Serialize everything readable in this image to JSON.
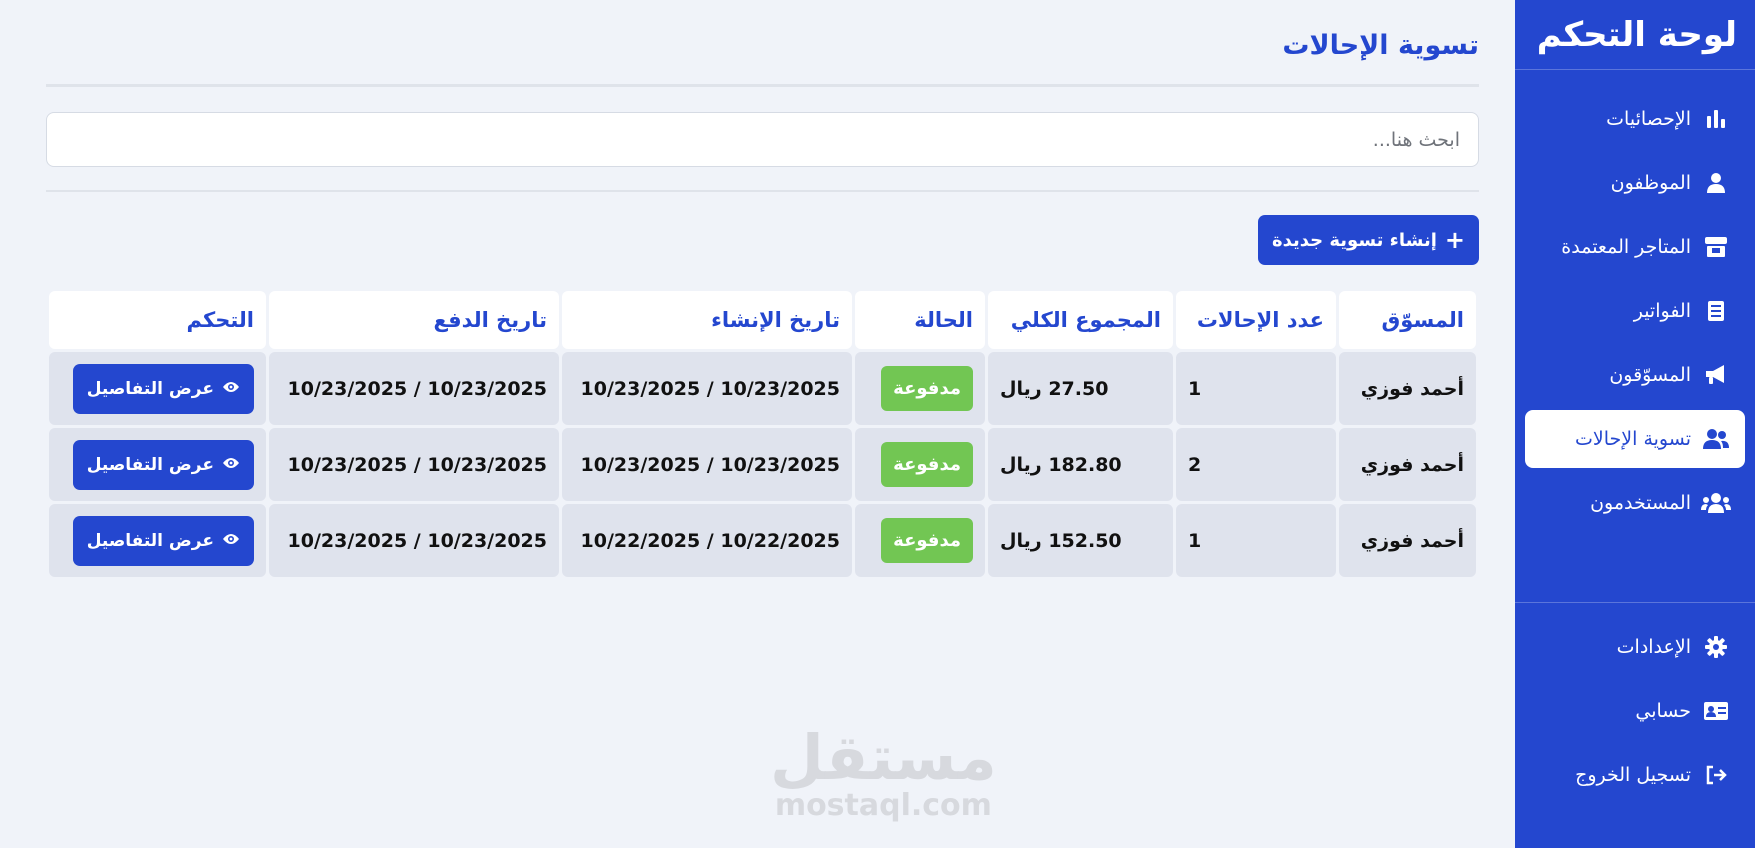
{
  "sidebar": {
    "title": "لوحة التحكم",
    "items": [
      {
        "label": "الإحصائيات",
        "icon": "chart-bar-icon"
      },
      {
        "label": "الموظفون",
        "icon": "user-tie-icon"
      },
      {
        "label": "المتاجر المعتمدة",
        "icon": "store-icon"
      },
      {
        "label": "الفواتير",
        "icon": "receipt-icon"
      },
      {
        "label": "المسوّقون",
        "icon": "megaphone-icon"
      },
      {
        "label": "تسوية الإحالات",
        "icon": "user-group-icon",
        "active": true
      },
      {
        "label": "المستخدمون",
        "icon": "users-icon"
      }
    ],
    "bottom_items": [
      {
        "label": "الإعدادات",
        "icon": "gear-icon"
      },
      {
        "label": "حسابي",
        "icon": "id-card-icon"
      },
      {
        "label": "تسجيل الخروج",
        "icon": "logout-icon"
      }
    ]
  },
  "page": {
    "title": "تسوية الإحالات",
    "search_placeholder": "ابحث هنا...",
    "create_button": "إنشاء تسوية جديدة",
    "create_button_icon": "+"
  },
  "table": {
    "headers": [
      "المسوّق",
      "عدد الإحالات",
      "المجموع الكلي",
      "الحالة",
      "تاريخ الإنشاء",
      "تاريخ الدفع",
      "التحكم"
    ],
    "rows": [
      {
        "marketer": "أحمد فوزي",
        "count": "1",
        "total": "27.50 ريال",
        "status": "مدفوعة",
        "created": "10/23/2025 / 10/23/2025",
        "paid": "10/23/2025 / 10/23/2025",
        "action": "عرض التفاصيل"
      },
      {
        "marketer": "أحمد فوزي",
        "count": "2",
        "total": "182.80 ريال",
        "status": "مدفوعة",
        "created": "10/23/2025 / 10/23/2025",
        "paid": "10/23/2025 / 10/23/2025",
        "action": "عرض التفاصيل"
      },
      {
        "marketer": "أحمد فوزي",
        "count": "1",
        "total": "152.50 ريال",
        "status": "مدفوعة",
        "created": "10/22/2025 / 10/22/2025",
        "paid": "10/23/2025 / 10/23/2025",
        "action": "عرض التفاصيل"
      }
    ]
  },
  "watermark": {
    "arabic": "مستقل",
    "latin": "mostaql.com"
  },
  "colors": {
    "primary": "#2447cf",
    "paid_badge": "#72c653",
    "background": "#f0f3f9",
    "cell": "#dfe3ed"
  }
}
